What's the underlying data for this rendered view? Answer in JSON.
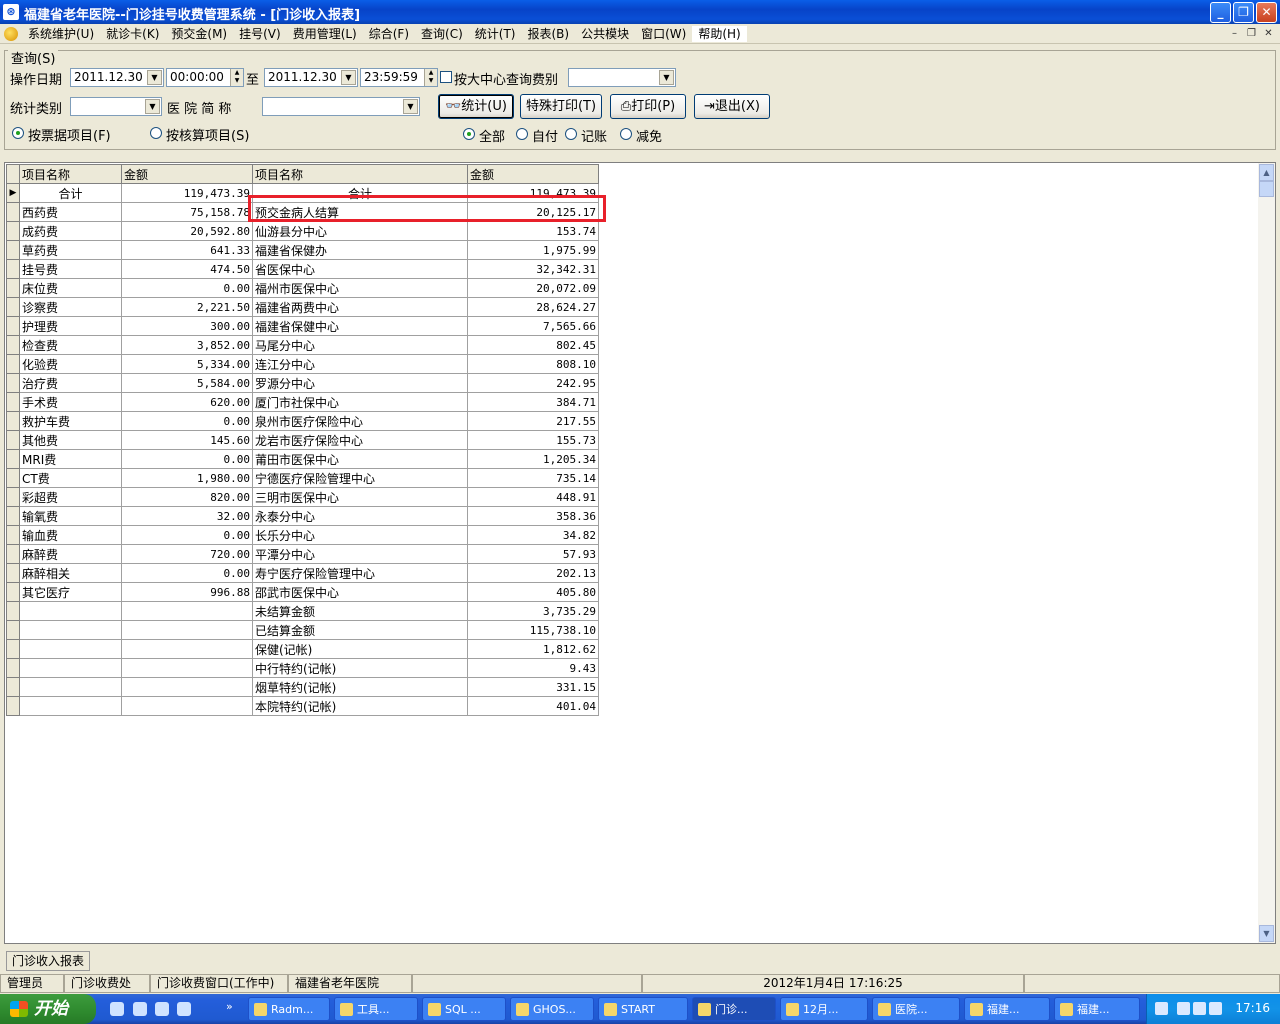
{
  "window": {
    "title": "福建省老年医院--门诊挂号收费管理系统 - [门诊收入报表]",
    "icon": "app-icon",
    "controls": [
      "minimize-icon",
      "restore-icon",
      "close-icon"
    ]
  },
  "menu": {
    "items": [
      "系统维护(U)",
      "就诊卡(K)",
      "预交金(M)",
      "挂号(V)",
      "费用管理(L)",
      "综合(F)",
      "查询(C)",
      "统计(T)",
      "报表(B)",
      "公共模块",
      "窗口(W)",
      "帮助(H)"
    ]
  },
  "query": {
    "group_title": "查询(S)",
    "date_label": "操作日期",
    "date_from": "2011.12.30",
    "time_from": "00:00:00",
    "to_label": "至",
    "date_to": "2011.12.30",
    "time_to": "23:59:59",
    "center_check_label": "按大中心查询费别",
    "center_value": "",
    "stat_category_label": "统计类别",
    "stat_category_value": "",
    "hospital_label": "医 院 简 称",
    "hospital_value": "",
    "btn_stat": "统计(U)",
    "btn_special_print": "特殊打印(T)",
    "btn_print": "打印(P)",
    "btn_exit": "退出(X)",
    "radio_by_receipt": "按票据项目(F)",
    "radio_by_accounting": "按核算项目(S)",
    "radio_all": "全部",
    "radio_self_pay": "自付",
    "radio_credit": "记账",
    "radio_waive": "减免"
  },
  "grid": {
    "headers": [
      "项目名称",
      "金额",
      "项目名称",
      "金额"
    ],
    "rows": [
      [
        "合计",
        "119,473.39",
        "合计",
        "119,473.39"
      ],
      [
        "西药费",
        "75,158.78",
        "预交金病人结算",
        "20,125.17"
      ],
      [
        "成药费",
        "20,592.80",
        "仙游县分中心",
        "153.74"
      ],
      [
        "草药费",
        "641.33",
        "福建省保健办",
        "1,975.99"
      ],
      [
        "挂号费",
        "474.50",
        "省医保中心",
        "32,342.31"
      ],
      [
        "床位费",
        "0.00",
        "福州市医保中心",
        "20,072.09"
      ],
      [
        "诊察费",
        "2,221.50",
        "福建省两费中心",
        "28,624.27"
      ],
      [
        "护理费",
        "300.00",
        "福建省保健中心",
        "7,565.66"
      ],
      [
        "检查费",
        "3,852.00",
        "马尾分中心",
        "802.45"
      ],
      [
        "化验费",
        "5,334.00",
        "连江分中心",
        "808.10"
      ],
      [
        "治疗费",
        "5,584.00",
        "罗源分中心",
        "242.95"
      ],
      [
        "手术费",
        "620.00",
        "厦门市社保中心",
        "384.71"
      ],
      [
        "救护车费",
        "0.00",
        "泉州市医疗保险中心",
        "217.55"
      ],
      [
        "其他费",
        "145.60",
        "龙岩市医疗保险中心",
        "155.73"
      ],
      [
        "MRI费",
        "0.00",
        "莆田市医保中心",
        "1,205.34"
      ],
      [
        "CT费",
        "1,980.00",
        "宁德医疗保险管理中心",
        "735.14"
      ],
      [
        "彩超费",
        "820.00",
        "三明市医保中心",
        "448.91"
      ],
      [
        "输氧费",
        "32.00",
        "永泰分中心",
        "358.36"
      ],
      [
        "输血费",
        "0.00",
        "长乐分中心",
        "34.82"
      ],
      [
        "麻醉费",
        "720.00",
        "平潭分中心",
        "57.93"
      ],
      [
        "麻醉相关",
        "0.00",
        "寿宁医疗保险管理中心",
        "202.13"
      ],
      [
        "其它医疗",
        "996.88",
        "邵武市医保中心",
        "405.80"
      ],
      [
        "",
        "",
        "未结算金额",
        "3,735.29"
      ],
      [
        "",
        "",
        "已结算金额",
        "115,738.10"
      ],
      [
        "",
        "",
        "保健(记帐)",
        "1,812.62"
      ],
      [
        "",
        "",
        "中行特约(记帐)",
        "9.43"
      ],
      [
        "",
        "",
        "烟草特约(记帐)",
        "331.15"
      ],
      [
        "",
        "",
        "本院特约(记帐)",
        "401.04"
      ]
    ]
  },
  "sheet_tab": "门诊收入报表",
  "status": {
    "user": "管理员",
    "dept": "门诊收费处",
    "window": "门诊收费窗口(工作中)",
    "hospital": "福建省老年医院",
    "datetime": "2012年1月4日  17:16:25"
  },
  "taskbar": {
    "start": "开始",
    "tasks": [
      "Radm...",
      "工具...",
      "SQL ...",
      "GHOS...",
      "START",
      "门诊...",
      "12月...",
      "医院...",
      "福建...",
      "福建..."
    ],
    "clock": "17:16"
  },
  "colors": {
    "highlight": "#e8202a",
    "titlebar": "#0A4FD6"
  }
}
